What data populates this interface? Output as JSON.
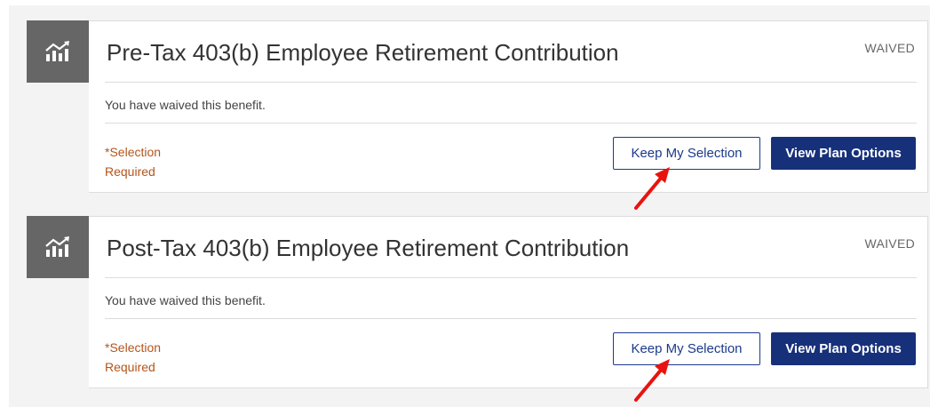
{
  "colors": {
    "accent": "#17307a",
    "requiredText": "#b5541a",
    "arrow": "#e8130f",
    "iconTile": "#666666"
  },
  "cards": [
    {
      "icon": "chart-growth-icon",
      "title": "Pre-Tax 403(b) Employee Retirement Contribution",
      "status": "WAIVED",
      "description": "You have waived this benefit.",
      "required_asterisk": "*",
      "required_line1": "Selection",
      "required_line2": "Required",
      "keep_label": "Keep My Selection",
      "view_label": "View Plan Options"
    },
    {
      "icon": "chart-growth-icon",
      "title": "Post-Tax 403(b) Employee Retirement Contribution",
      "status": "WAIVED",
      "description": "You have waived this benefit.",
      "required_asterisk": "*",
      "required_line1": "Selection",
      "required_line2": "Required",
      "keep_label": "Keep My Selection",
      "view_label": "View Plan Options"
    }
  ]
}
